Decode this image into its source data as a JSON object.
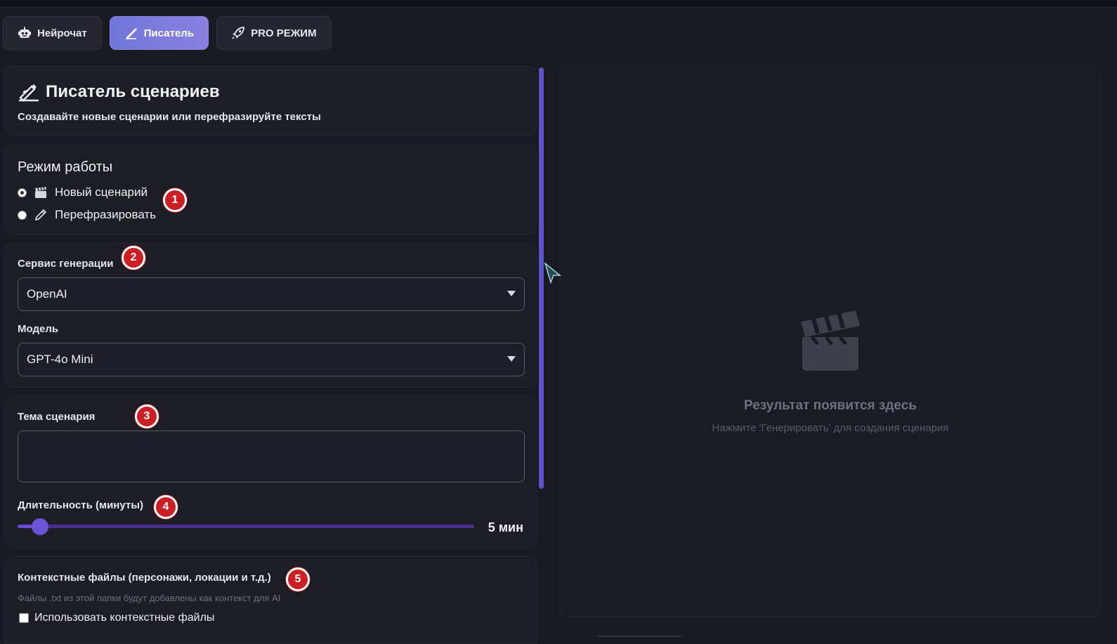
{
  "tabs": [
    {
      "label": "Нейрочат",
      "icon": "robot-icon",
      "active": false
    },
    {
      "label": "Писатель",
      "icon": "writing-hand-icon",
      "active": true
    },
    {
      "label": "PRO РЕЖИМ",
      "icon": "rocket-icon",
      "active": false
    }
  ],
  "header": {
    "title": "Писатель сценариев",
    "subtitle": "Создавайте новые сценарии или перефразируйте тексты"
  },
  "mode": {
    "heading": "Режим работы",
    "options": [
      {
        "label": "Новый сценарий",
        "icon": "clapperboard-icon",
        "checked": true
      },
      {
        "label": "Перефразировать",
        "icon": "pencil-icon",
        "checked": false
      }
    ]
  },
  "service": {
    "label": "Сервис генерации",
    "value": "OpenAI"
  },
  "model": {
    "label": "Модель",
    "value": "GPT-4o Mini"
  },
  "topic": {
    "label": "Тема сценария",
    "value": ""
  },
  "duration": {
    "label": "Длительность (минуты)",
    "value_text": "5 мин",
    "fraction": 0.05
  },
  "context": {
    "label": "Контекстные файлы (персонажи, локации и т.д.)",
    "hint": "Файлы .txt из этой папки будут добавлены как контекст для AI",
    "checkbox_label": "Использовать контекстные файлы",
    "checked": false
  },
  "result": {
    "title": "Результат появится здесь",
    "hint": "Нажмите 'Генерировать' для создания сценария"
  },
  "badges": [
    "1",
    "2",
    "3",
    "4",
    "5"
  ],
  "colors": {
    "accent": "#6f77d8",
    "slider": "#5b3fb8",
    "badge": "#cc1f24"
  }
}
